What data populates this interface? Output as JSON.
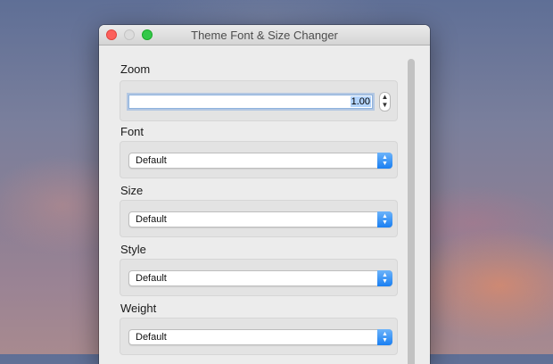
{
  "window": {
    "title": "Theme Font & Size Changer"
  },
  "zoom": {
    "label": "Zoom",
    "value": "1.00"
  },
  "font": {
    "label": "Font",
    "selected": "Default"
  },
  "size": {
    "label": "Size",
    "selected": "Default"
  },
  "style": {
    "label": "Style",
    "selected": "Default"
  },
  "weight": {
    "label": "Weight",
    "selected": "Default"
  },
  "icons": {
    "close": "close-button",
    "minimize": "minimize-button",
    "zoom": "zoom-button",
    "stepper": "stepper-icon",
    "select_arrows": "chevron-up-down-icon"
  },
  "colors": {
    "accent": "#1a7ff2",
    "close": "#fc605c",
    "zoom": "#34c84a"
  }
}
